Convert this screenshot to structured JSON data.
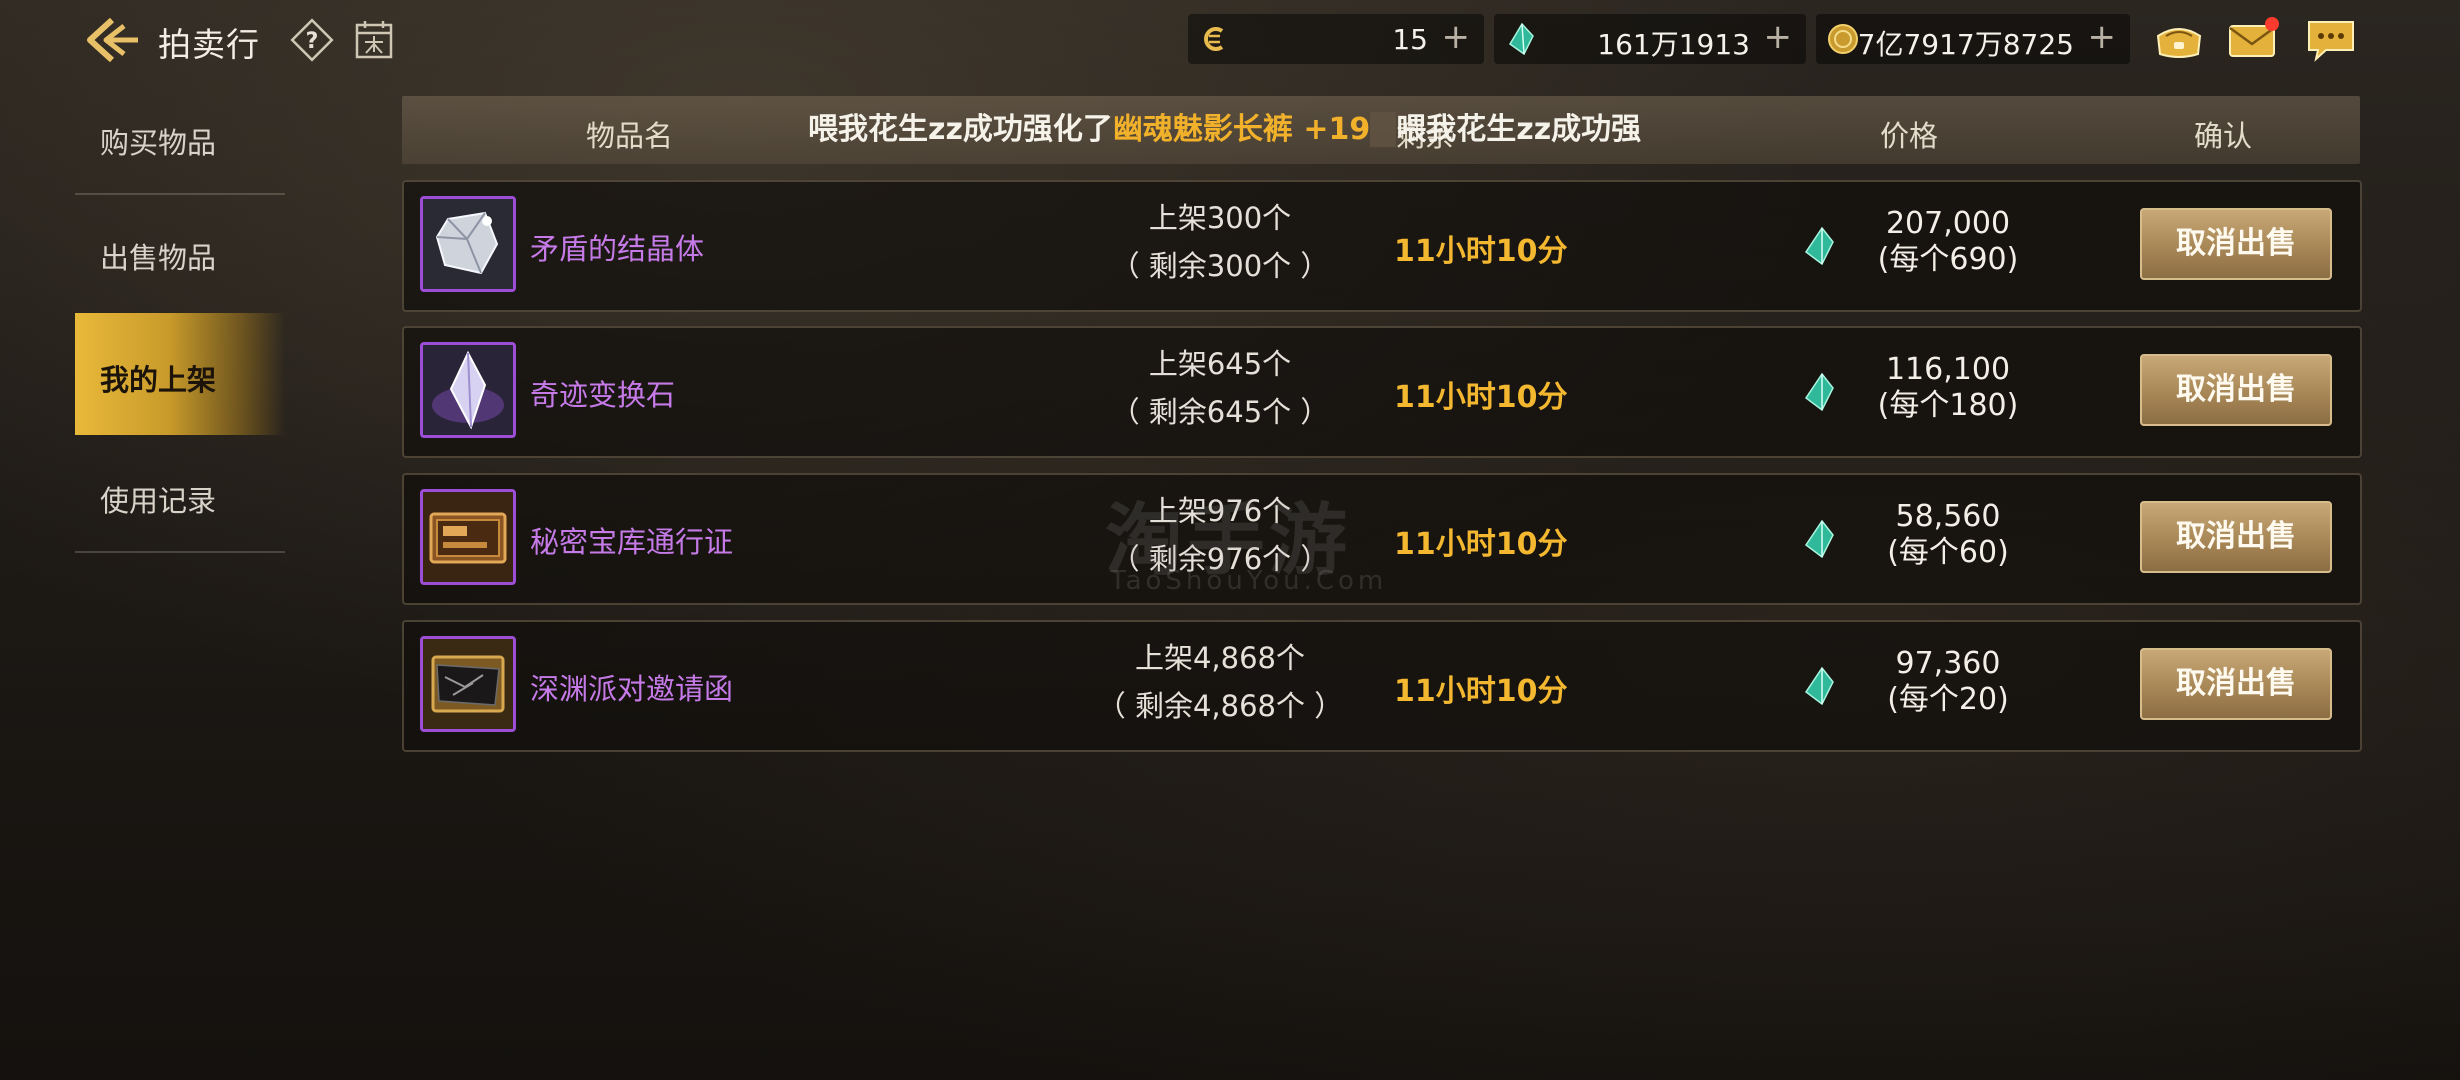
{
  "header": {
    "title": "拍卖行",
    "currencies": [
      {
        "value": "15",
        "icon": "c-coin-icon"
      },
      {
        "value": "161万1913",
        "icon": "green-gem-icon"
      },
      {
        "value": "7亿7917万8725",
        "icon": "gold-coin-icon"
      }
    ]
  },
  "sidebar": {
    "items": [
      {
        "label": "购买物品"
      },
      {
        "label": "出售物品"
      },
      {
        "label": "我的上架"
      },
      {
        "label": "使用记录"
      }
    ],
    "active_index": 2
  },
  "table": {
    "columns": {
      "name": "物品名",
      "remain": "剩余",
      "price": "价格",
      "confirm": "确认"
    },
    "marquee": {
      "prefix": "喂我花生zz成功强化了",
      "item": "幽魂魅影长裤 +19",
      "repeat": "喂我花生zz成功强"
    },
    "rows": [
      {
        "name": "矛盾的结晶体",
        "listed": "上架300个",
        "remaining": "（ 剩余300个 ）",
        "time": "11小时10分",
        "total": "207,000",
        "unit": "(每个690)",
        "action": "取消出售"
      },
      {
        "name": "奇迹变换石",
        "listed": "上架645个",
        "remaining": "（ 剩余645个 ）",
        "time": "11小时10分",
        "total": "116,100",
        "unit": "(每个180)",
        "action": "取消出售"
      },
      {
        "name": "秘密宝库通行证",
        "listed": "上架976个",
        "remaining": "（ 剩余976个 ）",
        "time": "11小时10分",
        "total": "58,560",
        "unit": "(每个60)",
        "action": "取消出售"
      },
      {
        "name": "深渊派对邀请函",
        "listed": "上架4,868个",
        "remaining": "（ 剩余4,868个 ）",
        "time": "11小时10分",
        "total": "97,360",
        "unit": "(每个20)",
        "action": "取消出售"
      }
    ]
  },
  "watermark": {
    "main": "淘手游",
    "sub": "TaoShouYou.Com"
  },
  "colors": {
    "accent": "#f2b12b",
    "item_name": "#c57ae8",
    "time": "#f3b730",
    "button": "#a88757",
    "active_tab": "#e9b93a"
  }
}
